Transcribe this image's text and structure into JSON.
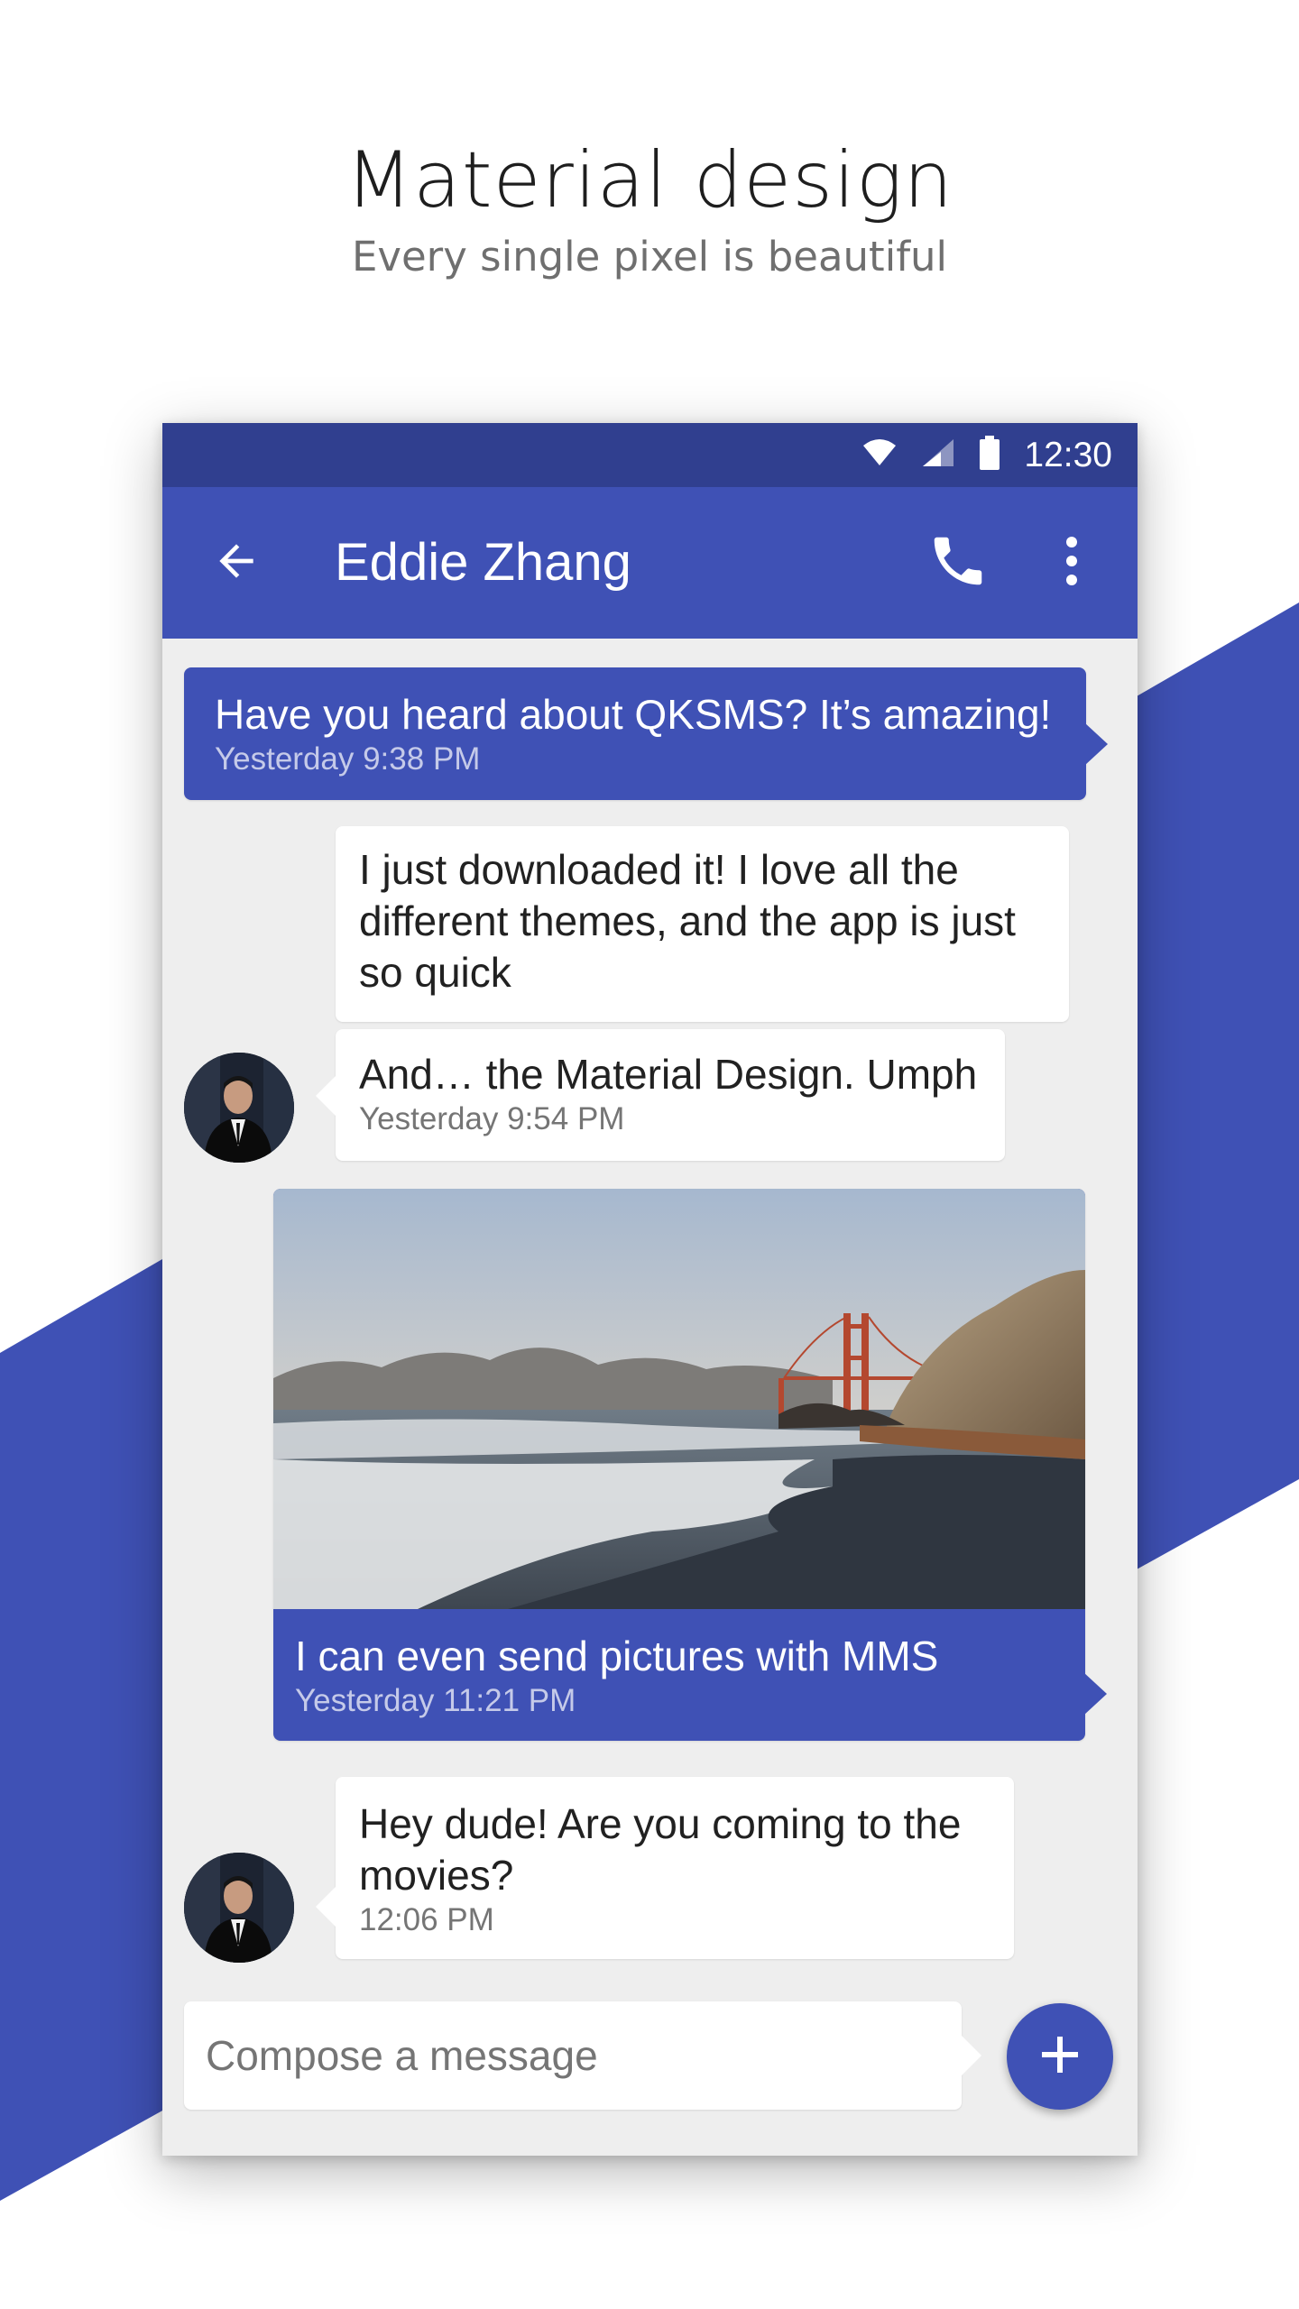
{
  "promo": {
    "title": "Material design",
    "subtitle": "Every single pixel is beautiful"
  },
  "status_bar": {
    "time": "12:30",
    "icons": [
      "wifi-icon",
      "cell-signal-icon",
      "battery-icon"
    ]
  },
  "app_bar": {
    "back_icon": "arrow-back-icon",
    "contact_name": "Eddie Zhang",
    "actions": [
      "phone-icon",
      "more-vert-icon"
    ]
  },
  "messages": [
    {
      "direction": "sent",
      "text": "Have you heard about QKSMS? It’s amazing!",
      "time": "Yesterday 9:38 PM"
    },
    {
      "direction": "received",
      "text": "I just downloaded it! I love all the different themes, and the app is just so quick"
    },
    {
      "direction": "received",
      "text": "And… the Material Design. Umph",
      "time": "Yesterday 9:54 PM"
    },
    {
      "direction": "sent",
      "attachment": "photo",
      "text": "I can even send pictures with MMS",
      "time": "Yesterday 11:21 PM"
    },
    {
      "direction": "received",
      "text": "Hey dude! Are you coming to the movies?",
      "time": "12:06 PM"
    }
  ],
  "compose": {
    "placeholder": "Compose a message",
    "value": "",
    "fab_icon": "add-icon"
  },
  "colors": {
    "primary": "#3f51b5",
    "primary_dark": "#303f8f",
    "background": "#eeeeee",
    "received_bubble": "#ffffff",
    "sent_time": "#c5cae9"
  }
}
